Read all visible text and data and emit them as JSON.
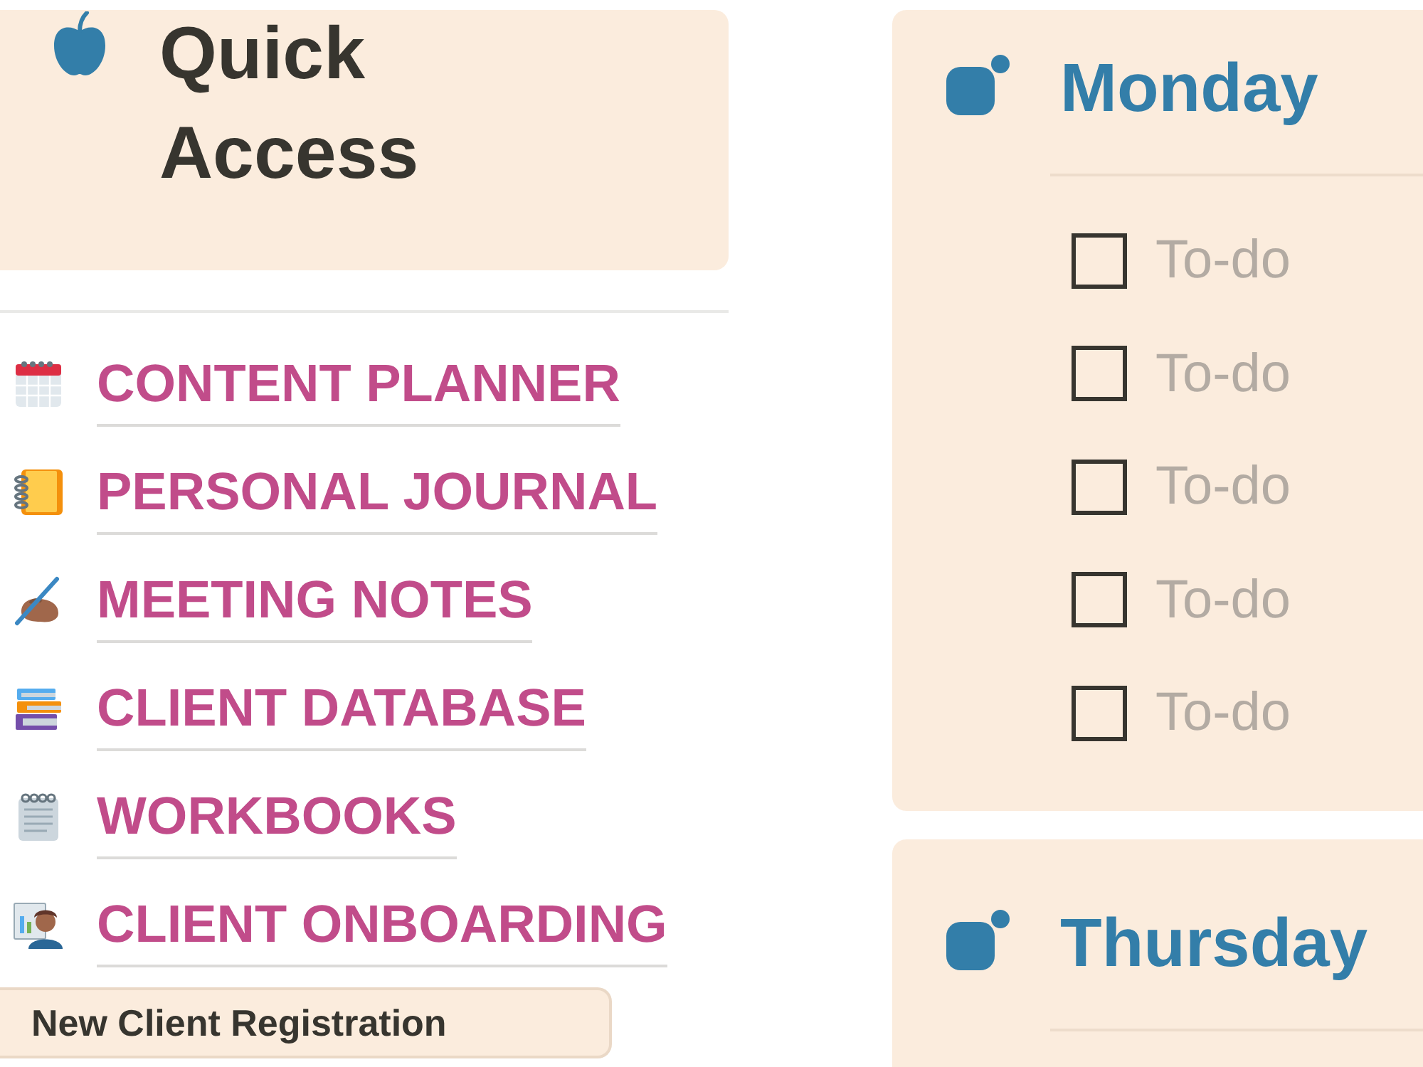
{
  "quick_access": {
    "title": "Quick Access"
  },
  "links": [
    {
      "label": "CONTENT PLANNER"
    },
    {
      "label": "PERSONAL JOURNAL"
    },
    {
      "label": "MEETING NOTES"
    },
    {
      "label": "CLIENT DATABASE"
    },
    {
      "label": "WORKBOOKS"
    },
    {
      "label": "CLIENT ONBOARDING"
    }
  ],
  "registration_button": {
    "label": "New Client Registration"
  },
  "days": [
    {
      "name": "Monday",
      "todos": [
        {
          "placeholder": "To-do",
          "checked": false
        },
        {
          "placeholder": "To-do",
          "checked": false
        },
        {
          "placeholder": "To-do",
          "checked": false
        },
        {
          "placeholder": "To-do",
          "checked": false
        },
        {
          "placeholder": "To-do",
          "checked": false
        }
      ]
    },
    {
      "name": "Thursday"
    }
  ]
}
